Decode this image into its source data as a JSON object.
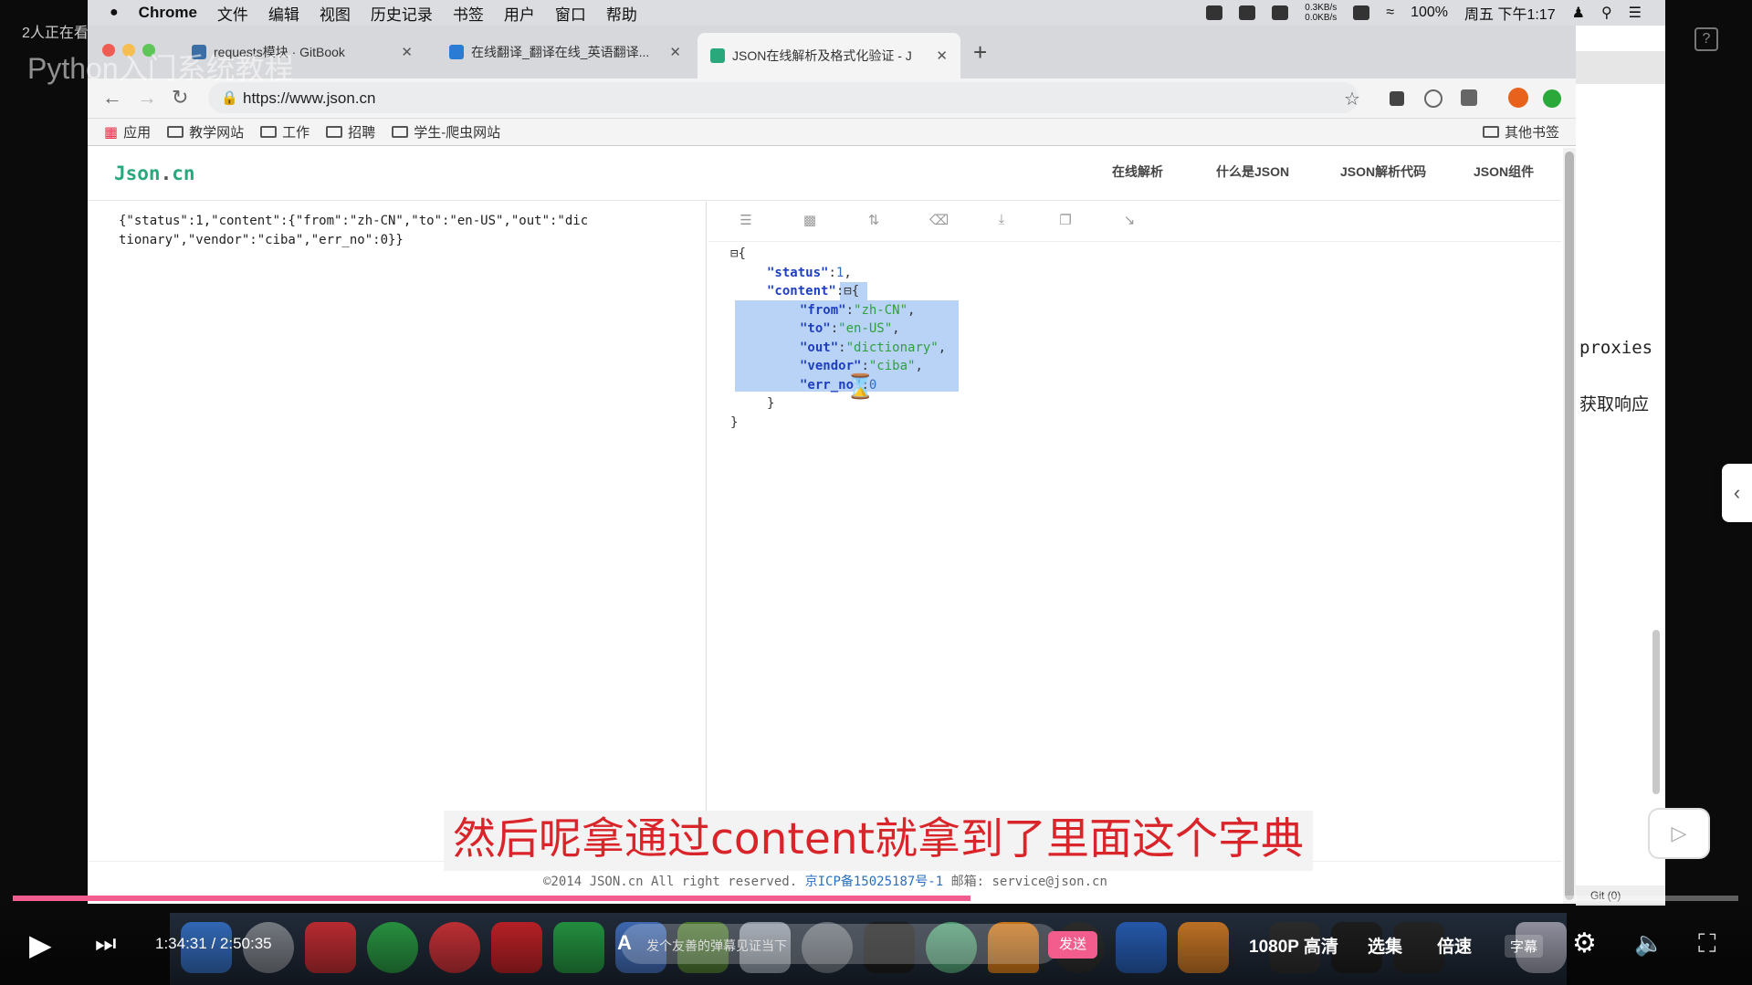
{
  "menubar": {
    "app": "Chrome",
    "items": [
      "文件",
      "编辑",
      "视图",
      "历史记录",
      "书签",
      "用户",
      "窗口",
      "帮助"
    ],
    "net_up": "0.3KB/s",
    "net_down": "0.0KB/s",
    "battery": "100%",
    "datetime": "周五 下午1:17"
  },
  "tabs": [
    {
      "title": "requests模块 · GitBook",
      "favicon_color": "#3a6ea5"
    },
    {
      "title": "在线翻译_翻译在线_英语翻译...",
      "favicon_color": "#2a7bd4"
    },
    {
      "title": "JSON在线解析及格式化验证 - J",
      "favicon_color": "#2aa87c"
    }
  ],
  "address": {
    "url": "https://www.json.cn"
  },
  "bookmarks": {
    "apps": "应用",
    "items": [
      "教学网站",
      "工作",
      "招聘",
      "学生-爬虫网站"
    ],
    "other": "其他书签"
  },
  "site": {
    "logo_main": "Json",
    "logo_dot": ".",
    "logo_tld": "cn",
    "nav": [
      "在线解析",
      "什么是JSON",
      "JSON解析代码",
      "JSON组件"
    ],
    "raw_input": "{\"status\":1,\"content\":{\"from\":\"zh-CN\",\"to\":\"en-US\",\"out\":\"dictionary\",\"vendor\":\"ciba\",\"err_no\":0}}",
    "toolbar_icons": [
      "database-icon",
      "file-icon",
      "sort-icon",
      "trash-icon",
      "download-icon",
      "copy-icon",
      "compress-icon"
    ],
    "tree": {
      "status_key": "\"status\"",
      "status_val": "1",
      "content_key": "\"content\"",
      "from_key": "\"from\"",
      "from_val": "\"zh-CN\"",
      "to_key": "\"to\"",
      "to_val": "\"en-US\"",
      "out_key": "\"out\"",
      "out_val": "\"dictionary\"",
      "vendor_key": "\"vendor\"",
      "vendor_val": "\"ciba\"",
      "errno_key": "\"err_no\"",
      "errno_val": "0"
    },
    "footer_copy": "©2014 JSON.cn All right reserved.",
    "footer_icp": "京ICP备15025187号-1",
    "footer_mail": "邮箱: service@json.cn"
  },
  "background_window": {
    "text1": "proxies",
    "text2": "获取响应",
    "git": "Git (0)"
  },
  "video": {
    "watching": "2人正在看",
    "watermark": "Python入门系统教程",
    "subtitle": "然后呢拿通过content就拿到了里面这个字典",
    "current_time": "1:34:31",
    "total_time": "2:50:35",
    "progress": 0.555,
    "danmu_placeholder": "发个友善的弹幕见证当下",
    "send": "发送",
    "quality": "1080P 高清",
    "episodes": "选集",
    "speed": "倍速",
    "cc": "字幕"
  }
}
